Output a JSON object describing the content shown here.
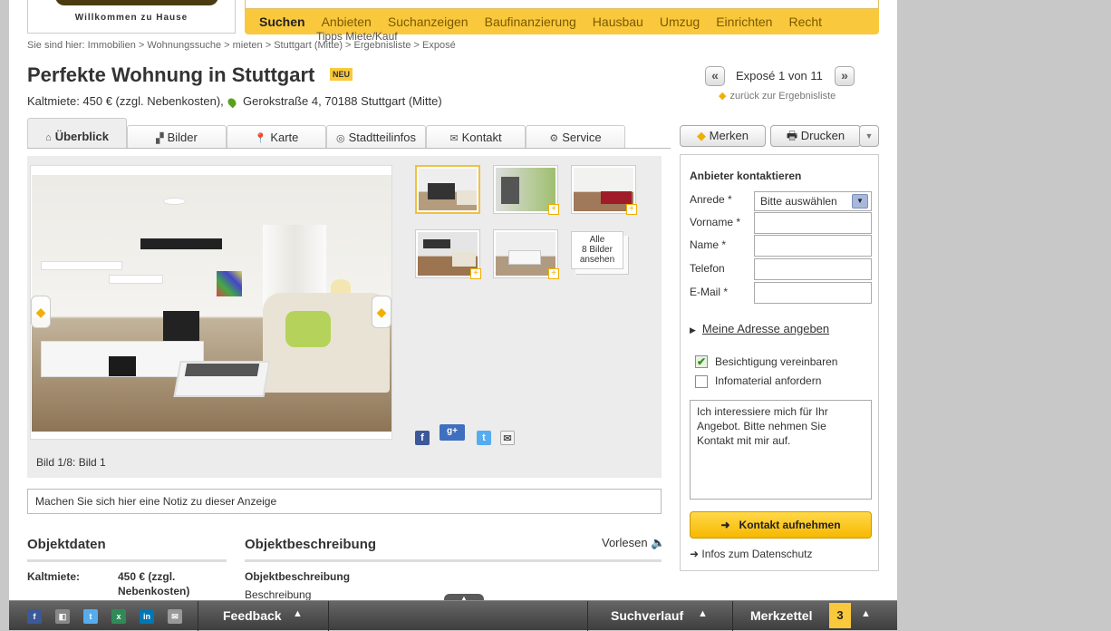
{
  "header": {
    "tagline": "Willkommen zu Hause",
    "nav": [
      "Suchen",
      "Anbieten",
      "Suchanzeigen",
      "Baufinanzierung",
      "Hausbau",
      "Umzug",
      "Einrichten",
      "Recht"
    ],
    "nav_sub": "Tipps Miete/Kauf"
  },
  "breadcrumb": "Sie sind hier: Immobilien > Wohnungssuche > mieten > Stuttgart (Mitte) > Ergebnisliste > Exposé",
  "listing": {
    "title": "Perfekte Wohnung in Stuttgart",
    "badge": "NEU",
    "rent": "Kaltmiete: 450 € (zzgl. Nebenkosten),",
    "address": "Gerokstraße 4, 70188 Stuttgart (Mitte)"
  },
  "expose_nav": {
    "prev": "«",
    "label": "Exposé 1 von 11",
    "next": "»",
    "back": "zurück zur Ergebnisliste"
  },
  "tabs": [
    "Überblick",
    "Bilder",
    "Karte",
    "Stadtteilinfos",
    "Kontakt",
    "Service"
  ],
  "actions": {
    "merken": "Merken",
    "drucken": "Drucken"
  },
  "gallery": {
    "caption": "Bild 1/8: Bild 1",
    "all_images": [
      "Alle",
      "8 Bilder",
      "ansehen"
    ]
  },
  "note_placeholder": "Machen Sie sich hier eine Notiz zu dieser Anzeige",
  "objektdaten": {
    "title": "Objektdaten",
    "label": "Kaltmiete:",
    "value_line1": "450 € (zzgl.",
    "value_line2": "Nebenkosten)"
  },
  "beschreibung": {
    "title": "Objektbeschreibung",
    "read_aloud": "Vorlesen",
    "subtitle": "Objektbeschreibung",
    "text": "Beschreibung"
  },
  "contact": {
    "title": "Anbieter kontaktieren",
    "anrede_label": "Anrede *",
    "anrede_value": "Bitte auswählen",
    "vorname": "Vorname *",
    "name": "Name *",
    "telefon": "Telefon",
    "email": "E-Mail *",
    "address_link": "Meine Adresse angeben",
    "checkbox1": "Besichtigung vereinbaren",
    "checkbox1_checked": true,
    "checkbox2": "Infomaterial anfordern",
    "checkbox2_checked": false,
    "message": "Ich interessiere mich für Ihr Angebot. Bitte nehmen Sie Kontakt mit mir auf.",
    "submit": "Kontakt aufnehmen",
    "privacy": "Infos zum Datenschutz"
  },
  "bottombar": {
    "feedback": "Feedback",
    "history": "Suchverlauf",
    "watchlist": "Merkzettel",
    "watchlist_count": "3"
  },
  "colors": {
    "accent": "#fac83c",
    "bar": "#4a4a4a"
  }
}
